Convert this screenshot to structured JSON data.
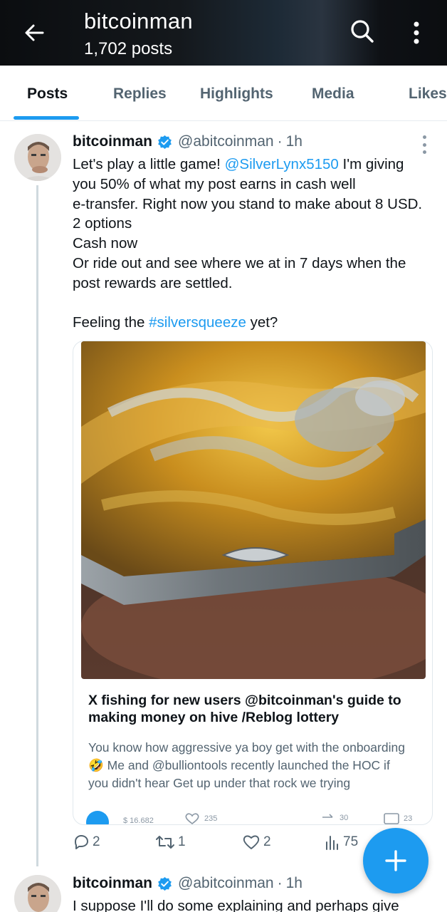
{
  "header": {
    "title": "bitcoinman",
    "subtitle": "1,702 posts",
    "icons": [
      "back-arrow-icon",
      "search-icon",
      "more-vertical-icon"
    ]
  },
  "tabs": [
    {
      "label": "Posts",
      "active": true
    },
    {
      "label": "Replies",
      "active": false
    },
    {
      "label": "Highlights",
      "active": false
    },
    {
      "label": "Media",
      "active": false
    },
    {
      "label": "Likes",
      "active": false
    }
  ],
  "post": {
    "author_name": "bitcoinman",
    "handle": "@abitcoinman",
    "separator": "·",
    "time": "1h",
    "text_lines": {
      "l1_pre": "Let's play a little game! ",
      "l1_mention": "@SilverLynx5150",
      "l1_post": " I'm giving",
      "l2": "you 50% of what my post earns in cash well",
      "l3": "e-transfer. Right now you stand to make about 8 USD.",
      "l4": "2 options",
      "l5": "Cash now",
      "l6": "Or ride out and see where we at in 7 days when the",
      "l7": "post rewards are settled.",
      "l8_pre": "Feeling the ",
      "l8_tag": "#silversqueeze",
      "l8_post": " yet?"
    },
    "card": {
      "image_subject": "silver-bee-coin-photo",
      "title_line1": "X fishing for new users @bitcoinman's guide to",
      "title_line2": "making money on hive /Reblog lottery",
      "desc_line1": "You know how aggressive ya boy get with the onboarding",
      "desc_line2_emoji": "🤣",
      "desc_line2": " Me and @bulliontools recently launched the HOC if",
      "desc_line3": "you didn't hear Get up under that rock we trying",
      "stats": {
        "amount": "$ 16.682",
        "likes": "235",
        "reblogs": "30",
        "comments": "23"
      }
    },
    "actions": {
      "replies": "2",
      "reposts": "1",
      "likes": "2",
      "views": "75"
    }
  },
  "post2": {
    "author_name": "bitcoinman",
    "handle": "@abitcoinman",
    "separator": "·",
    "time": "1h",
    "text_start": "I suppose I'll do some explaining and perhaps give"
  },
  "fab": {
    "icon": "plus-icon"
  },
  "colors": {
    "accent": "#1d9bf0",
    "text": "#0f1419",
    "secondary": "#536471",
    "border": "#cfd9de"
  }
}
